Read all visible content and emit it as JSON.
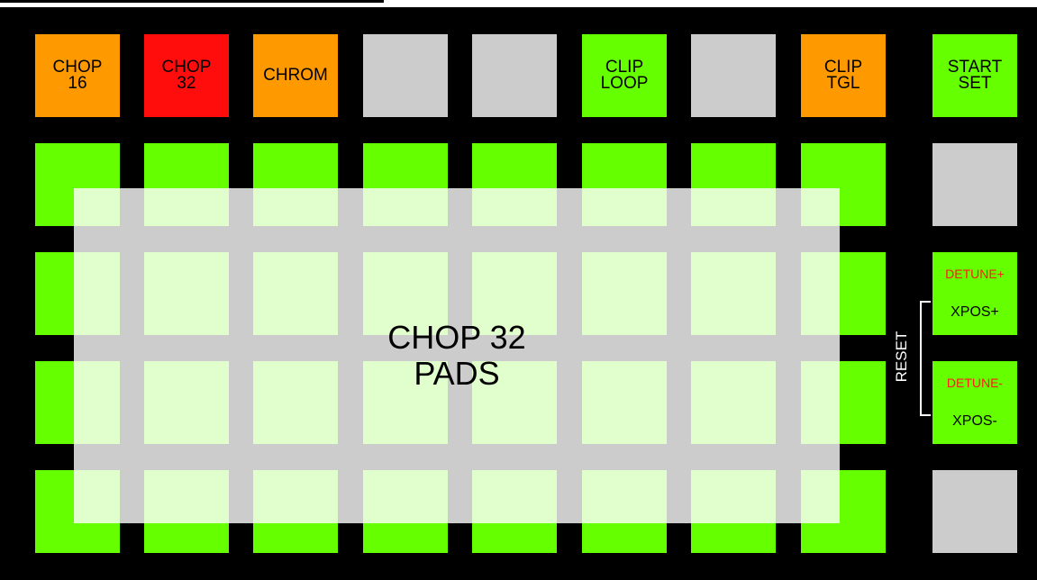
{
  "top_row": [
    {
      "label": "CHOP\n16",
      "color": "#ff9900"
    },
    {
      "label": "CHOP\n32",
      "color": "#ff0d0d"
    },
    {
      "label": "CHROM",
      "color": "#ff9900"
    },
    {
      "label": "",
      "color": "#cccccc"
    },
    {
      "label": "",
      "color": "#cccccc"
    },
    {
      "label": "CLIP\nLOOP",
      "color": "#66ff00"
    },
    {
      "label": "",
      "color": "#cccccc"
    },
    {
      "label": "CLIP\nTGL",
      "color": "#ff9900"
    }
  ],
  "grid_color": "#66ff00",
  "overlay_label": "CHOP 32\nPADS",
  "side_column": {
    "start_set": {
      "label": "START\nSET",
      "color": "#66ff00"
    },
    "blank_upper_color": "#cccccc",
    "detune_plus": {
      "detune_label": "DETUNE+",
      "xpos_label": "XPOS+",
      "color": "#66ff00"
    },
    "detune_minus": {
      "detune_label": "DETUNE-",
      "xpos_label": "XPOS-",
      "color": "#66ff00"
    },
    "blank_lower_color": "#cccccc",
    "reset_label": "RESET"
  },
  "colors": {
    "background": "#000000",
    "detune_text": "#ff1a1a"
  }
}
